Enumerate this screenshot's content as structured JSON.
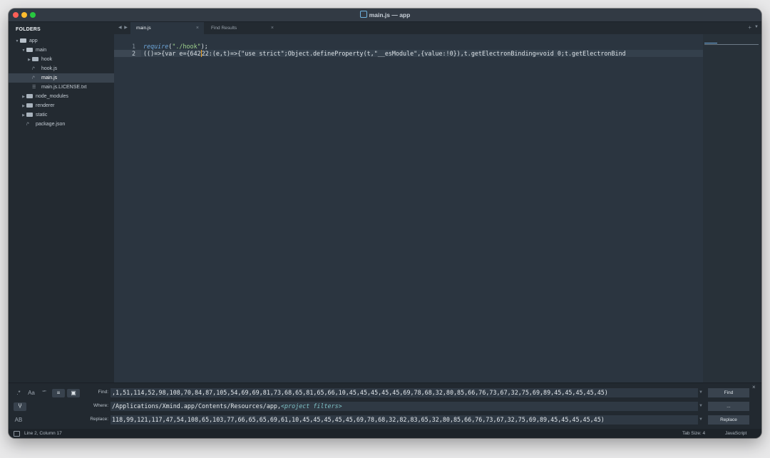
{
  "window": {
    "title": "main.js — app"
  },
  "sidebar": {
    "title": "FOLDERS",
    "items": [
      {
        "label": "app",
        "type": "folder-open"
      },
      {
        "label": "main",
        "type": "folder-open"
      },
      {
        "label": "hook",
        "type": "folder"
      },
      {
        "label": "hook.js",
        "type": "js"
      },
      {
        "label": "main.js",
        "type": "js",
        "selected": true
      },
      {
        "label": "main.js.LICENSE.txt",
        "type": "txt"
      },
      {
        "label": "node_modules",
        "type": "folder"
      },
      {
        "label": "renderer",
        "type": "folder"
      },
      {
        "label": "static",
        "type": "folder"
      },
      {
        "label": "package.json",
        "type": "js"
      }
    ]
  },
  "tabs": [
    {
      "label": "main.js",
      "close": "×",
      "active": true
    },
    {
      "label": "Find Results",
      "close": "×",
      "active": false
    }
  ],
  "tabbar": {
    "nav": "◀ ▶",
    "plus": "+",
    "menu": "▼"
  },
  "editor": {
    "line_numbers": [
      "1",
      "2"
    ],
    "line1": {
      "fn": "require",
      "open": "(",
      "str": "\"./hook\"",
      "close": ");"
    },
    "line2": {
      "before_cursor": "(()=>{var e={642",
      "after_cursor": "22:(e,t)=>{\"use strict\";Object.defineProperty(t,\"__esModule\",{value:!0}),t.getElectronBinding=void 0;t.getElectronBind"
    },
    "current_line": 2
  },
  "find_panel": {
    "options": [
      ".*",
      "Aa",
      "“”",
      "≡",
      "▣"
    ],
    "option_states": [
      false,
      false,
      false,
      true,
      true
    ],
    "row2_icon": "Ⴤ",
    "row3_icon": "AB",
    "find_label": "Find:",
    "find_value": ",1,51,114,52,98,108,70,84,87,105,54,69,69,81,73,68,65,81,65,66,10,45,45,45,45,45,69,78,68,32,80,85,66,76,73,67,32,75,69,89,45,45,45,45,45)",
    "where_label": "Where:",
    "where_value": "/Applications/Xmind.app/Contents/Resources/app,",
    "where_filters": "<project filters>",
    "replace_label": "Replace:",
    "replace_value": "118,99,121,117,47,54,108,65,103,77,66,65,65,69,61,10,45,45,45,45,45,69,78,68,32,82,83,65,32,80,85,66,76,73,67,32,75,69,89,45,45,45,45,45)",
    "find_button": "Find",
    "where_button": "...",
    "replace_button": "Replace",
    "dropdown": "▼",
    "close": "×"
  },
  "status_bar": {
    "position": "Line 2, Column 17",
    "tab_size": "Tab Size: 4",
    "syntax": "JavaScript"
  },
  "colors": {
    "accent": "#f5a623",
    "string": "#9fd38d",
    "keyword": "#6fa8dc"
  }
}
